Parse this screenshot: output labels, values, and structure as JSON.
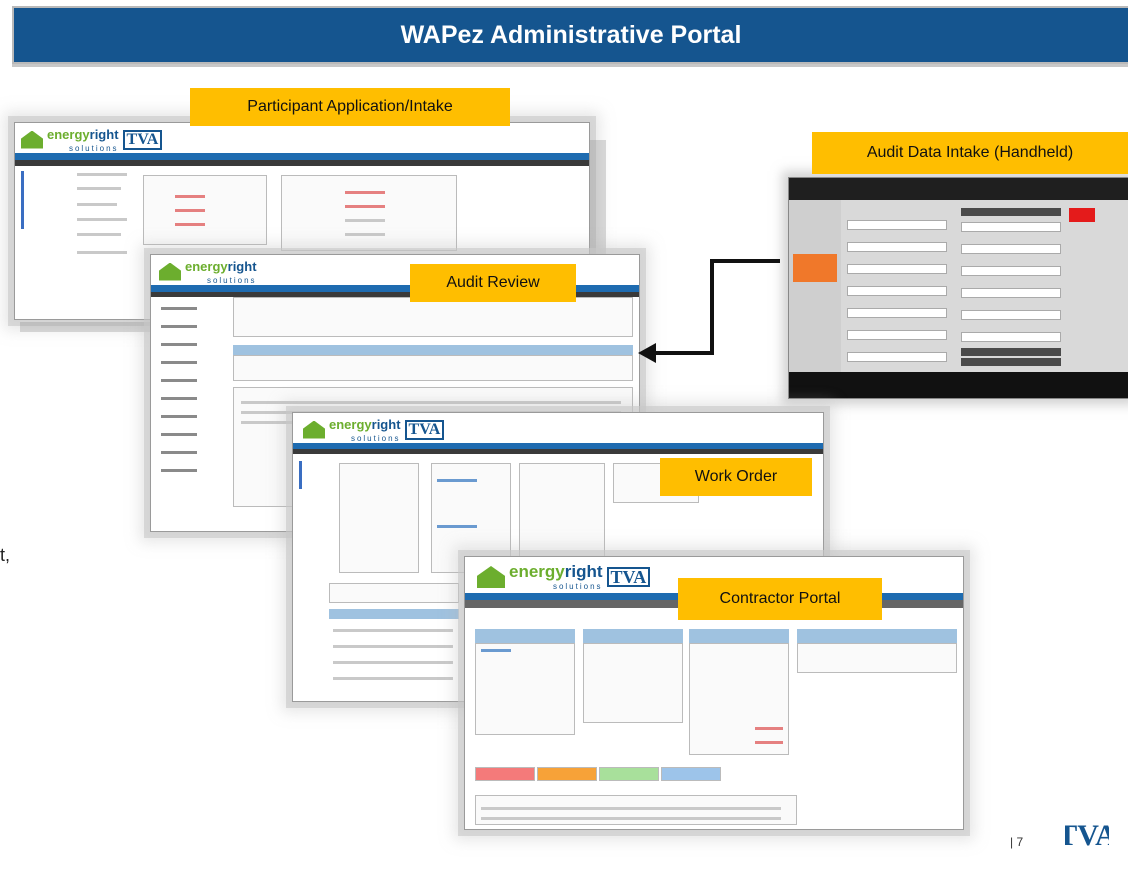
{
  "slide": {
    "title": "WAPez Administrative Portal",
    "page_number": "| 7",
    "edge_fragment": "t,",
    "brand_logo": "TVA"
  },
  "callouts": {
    "participant": "Participant Application/Intake",
    "audit_review": "Audit Review",
    "audit_data_intake": "Audit Data Intake (Handheld)",
    "work_order": "Work Order",
    "contractor_portal": "Contractor Portal"
  },
  "screenshot_branding": {
    "logo_word_a": "energy",
    "logo_word_b": "right",
    "logo_sub": "solutions",
    "logo_mark": "TVA"
  },
  "colors": {
    "title_bar": "#15558f",
    "callout": "#ffbe00",
    "nav_blue": "#1e6bb0",
    "handheld_accent": "#f0782a"
  }
}
